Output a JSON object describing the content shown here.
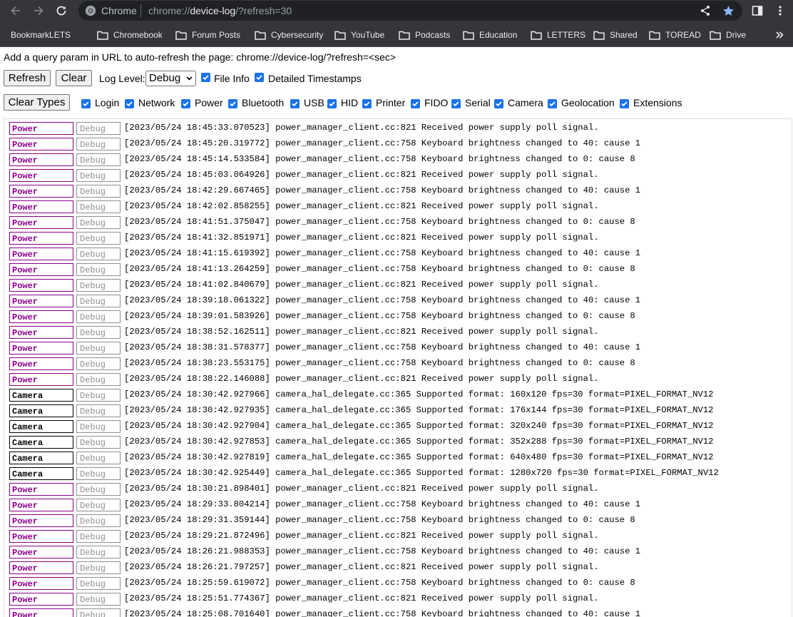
{
  "browser": {
    "omnibox": {
      "chip": "Chrome",
      "scheme": "chrome://",
      "host": "device-log",
      "path": "/?refresh=30"
    }
  },
  "bookmarks": [
    {
      "label": "BookmarkLETS",
      "type": "link"
    },
    {
      "label": "Chromebook",
      "type": "folder"
    },
    {
      "label": "Forum Posts",
      "type": "folder"
    },
    {
      "label": "Cybersecurity",
      "type": "folder"
    },
    {
      "label": "YouTube",
      "type": "folder"
    },
    {
      "label": "Podcasts",
      "type": "folder"
    },
    {
      "label": "Education",
      "type": "folder"
    },
    {
      "label": "LETTERS",
      "type": "folder"
    },
    {
      "label": "Shared",
      "type": "folder"
    },
    {
      "label": "TOREAD",
      "type": "folder"
    },
    {
      "label": "Drive",
      "type": "folder"
    }
  ],
  "page": {
    "hint": "Add a query param in URL to auto-refresh the page: chrome://device-log/?refresh=<sec>",
    "controls": {
      "refresh_label": "Refresh",
      "clear_label": "Clear",
      "log_level_label": "Log Level:",
      "log_level_value": "Debug",
      "file_info_label": "File Info",
      "file_info_checked": true,
      "detailed_timestamps_label": "Detailed Timestamps",
      "detailed_timestamps_checked": true,
      "clear_types_label": "Clear Types"
    },
    "types": [
      {
        "label": "Login",
        "checked": true
      },
      {
        "label": "Network",
        "checked": true
      },
      {
        "label": "Power",
        "checked": true
      },
      {
        "label": "Bluetooth",
        "checked": true
      },
      {
        "label": "USB",
        "checked": true
      },
      {
        "label": "HID",
        "checked": true
      },
      {
        "label": "Printer",
        "checked": true
      },
      {
        "label": "FIDO",
        "checked": true
      },
      {
        "label": "Serial",
        "checked": true
      },
      {
        "label": "Camera",
        "checked": true
      },
      {
        "label": "Geolocation",
        "checked": true
      },
      {
        "label": "Extensions",
        "checked": true
      }
    ],
    "log_entries": [
      {
        "type": "Power",
        "level": "Debug",
        "text": "[2023/05/24 18:45:33.070523] power_manager_client.cc:821 Received power supply poll signal."
      },
      {
        "type": "Power",
        "level": "Debug",
        "text": "[2023/05/24 18:45:20.319772] power_manager_client.cc:758 Keyboard brightness changed to 40: cause 1"
      },
      {
        "type": "Power",
        "level": "Debug",
        "text": "[2023/05/24 18:45:14.533584] power_manager_client.cc:758 Keyboard brightness changed to 0: cause 8"
      },
      {
        "type": "Power",
        "level": "Debug",
        "text": "[2023/05/24 18:45:03.064926] power_manager_client.cc:821 Received power supply poll signal."
      },
      {
        "type": "Power",
        "level": "Debug",
        "text": "[2023/05/24 18:42:29.667465] power_manager_client.cc:758 Keyboard brightness changed to 40: cause 1"
      },
      {
        "type": "Power",
        "level": "Debug",
        "text": "[2023/05/24 18:42:02.858255] power_manager_client.cc:821 Received power supply poll signal."
      },
      {
        "type": "Power",
        "level": "Debug",
        "text": "[2023/05/24 18:41:51.375047] power_manager_client.cc:758 Keyboard brightness changed to 0: cause 8"
      },
      {
        "type": "Power",
        "level": "Debug",
        "text": "[2023/05/24 18:41:32.851971] power_manager_client.cc:821 Received power supply poll signal."
      },
      {
        "type": "Power",
        "level": "Debug",
        "text": "[2023/05/24 18:41:15.619392] power_manager_client.cc:758 Keyboard brightness changed to 40: cause 1"
      },
      {
        "type": "Power",
        "level": "Debug",
        "text": "[2023/05/24 18:41:13.264259] power_manager_client.cc:758 Keyboard brightness changed to 0: cause 8"
      },
      {
        "type": "Power",
        "level": "Debug",
        "text": "[2023/05/24 18:41:02.840679] power_manager_client.cc:821 Received power supply poll signal."
      },
      {
        "type": "Power",
        "level": "Debug",
        "text": "[2023/05/24 18:39:18.061322] power_manager_client.cc:758 Keyboard brightness changed to 40: cause 1"
      },
      {
        "type": "Power",
        "level": "Debug",
        "text": "[2023/05/24 18:39:01.583926] power_manager_client.cc:758 Keyboard brightness changed to 0: cause 8"
      },
      {
        "type": "Power",
        "level": "Debug",
        "text": "[2023/05/24 18:38:52.162511] power_manager_client.cc:821 Received power supply poll signal."
      },
      {
        "type": "Power",
        "level": "Debug",
        "text": "[2023/05/24 18:38:31.578377] power_manager_client.cc:758 Keyboard brightness changed to 40: cause 1"
      },
      {
        "type": "Power",
        "level": "Debug",
        "text": "[2023/05/24 18:38:23.553175] power_manager_client.cc:758 Keyboard brightness changed to 0: cause 8"
      },
      {
        "type": "Power",
        "level": "Debug",
        "text": "[2023/05/24 18:38:22.146088] power_manager_client.cc:821 Received power supply poll signal."
      },
      {
        "type": "Camera",
        "level": "Debug",
        "text": "[2023/05/24 18:30:42.927966] camera_hal_delegate.cc:365 Supported format: 160x120 fps=30 format=PIXEL_FORMAT_NV12"
      },
      {
        "type": "Camera",
        "level": "Debug",
        "text": "[2023/05/24 18:30:42.927935] camera_hal_delegate.cc:365 Supported format: 176x144 fps=30 format=PIXEL_FORMAT_NV12"
      },
      {
        "type": "Camera",
        "level": "Debug",
        "text": "[2023/05/24 18:30:42.927904] camera_hal_delegate.cc:365 Supported format: 320x240 fps=30 format=PIXEL_FORMAT_NV12"
      },
      {
        "type": "Camera",
        "level": "Debug",
        "text": "[2023/05/24 18:30:42.927853] camera_hal_delegate.cc:365 Supported format: 352x288 fps=30 format=PIXEL_FORMAT_NV12"
      },
      {
        "type": "Camera",
        "level": "Debug",
        "text": "[2023/05/24 18:30:42.927819] camera_hal_delegate.cc:365 Supported format: 640x480 fps=30 format=PIXEL_FORMAT_NV12"
      },
      {
        "type": "Camera",
        "level": "Debug",
        "text": "[2023/05/24 18:30:42.925449] camera_hal_delegate.cc:365 Supported format: 1280x720 fps=30 format=PIXEL_FORMAT_NV12"
      },
      {
        "type": "Power",
        "level": "Debug",
        "text": "[2023/05/24 18:30:21.898401] power_manager_client.cc:821 Received power supply poll signal."
      },
      {
        "type": "Power",
        "level": "Debug",
        "text": "[2023/05/24 18:29:33.804214] power_manager_client.cc:758 Keyboard brightness changed to 40: cause 1"
      },
      {
        "type": "Power",
        "level": "Debug",
        "text": "[2023/05/24 18:29:31.359144] power_manager_client.cc:758 Keyboard brightness changed to 0: cause 8"
      },
      {
        "type": "Power",
        "level": "Debug",
        "text": "[2023/05/24 18:29:21.872496] power_manager_client.cc:821 Received power supply poll signal."
      },
      {
        "type": "Power",
        "level": "Debug",
        "text": "[2023/05/24 18:26:21.988353] power_manager_client.cc:758 Keyboard brightness changed to 40: cause 1"
      },
      {
        "type": "Power",
        "level": "Debug",
        "text": "[2023/05/24 18:26:21.797257] power_manager_client.cc:821 Received power supply poll signal."
      },
      {
        "type": "Power",
        "level": "Debug",
        "text": "[2023/05/24 18:25:59.619072] power_manager_client.cc:758 Keyboard brightness changed to 0: cause 8"
      },
      {
        "type": "Power",
        "level": "Debug",
        "text": "[2023/05/24 18:25:51.774367] power_manager_client.cc:821 Received power supply poll signal."
      },
      {
        "type": "Power",
        "level": "Debug",
        "text": "[2023/05/24 18:25:08.701640] power_manager_client.cc:758 Keyboard brightness changed to 40: cause 1"
      }
    ],
    "colors": {
      "power": "#8b008b",
      "camera": "#000000",
      "level": "#8f8f8f",
      "checkbox": "#1a73e8",
      "star": "#8ab4f8"
    }
  }
}
